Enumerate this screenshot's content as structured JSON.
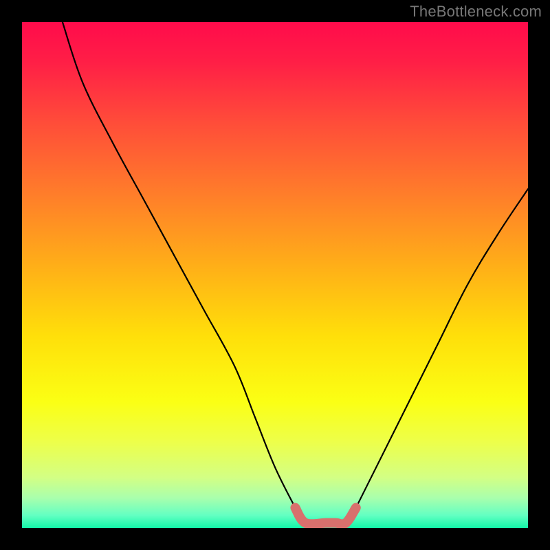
{
  "watermark": "TheBottleneck.com",
  "colors": {
    "black": "#000000",
    "curve": "#000000",
    "bump": "#d8706d",
    "gradient_stops": [
      {
        "pos": 0.0,
        "c": "#ff0b4b"
      },
      {
        "pos": 0.08,
        "c": "#ff1f46"
      },
      {
        "pos": 0.2,
        "c": "#ff4d39"
      },
      {
        "pos": 0.34,
        "c": "#ff7d2a"
      },
      {
        "pos": 0.48,
        "c": "#ffae18"
      },
      {
        "pos": 0.62,
        "c": "#ffdf0a"
      },
      {
        "pos": 0.75,
        "c": "#fbff14"
      },
      {
        "pos": 0.83,
        "c": "#edff4a"
      },
      {
        "pos": 0.9,
        "c": "#d3ff84"
      },
      {
        "pos": 0.94,
        "c": "#aaffac"
      },
      {
        "pos": 0.975,
        "c": "#63ffc2"
      },
      {
        "pos": 1.0,
        "c": "#13f7a8"
      }
    ]
  },
  "chart_data": {
    "type": "line",
    "title": "",
    "xlabel": "",
    "ylabel": "",
    "xlim": [
      0,
      100
    ],
    "ylim": [
      0,
      100
    ],
    "series": [
      {
        "name": "left-curve",
        "x": [
          8,
          12,
          18,
          24,
          30,
          36,
          42,
          46,
          50,
          54
        ],
        "y": [
          100,
          88,
          76,
          65,
          54,
          43,
          32,
          22,
          12,
          4
        ]
      },
      {
        "name": "right-curve",
        "x": [
          66,
          70,
          76,
          82,
          88,
          94,
          100
        ],
        "y": [
          4,
          12,
          24,
          36,
          48,
          58,
          67
        ]
      },
      {
        "name": "valley-bump",
        "x": [
          54,
          56,
          60,
          62,
          64,
          66
        ],
        "y": [
          4,
          1,
          1,
          1,
          1,
          4
        ]
      }
    ]
  }
}
